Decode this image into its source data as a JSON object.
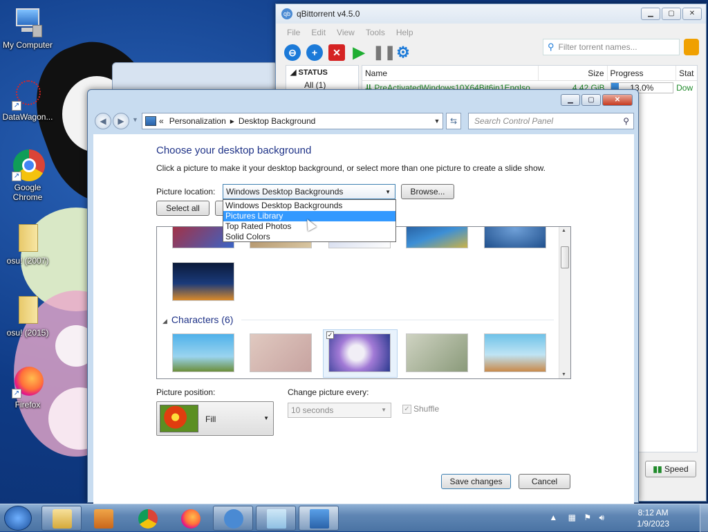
{
  "desktop": {
    "icons": [
      {
        "label": "My Computer"
      },
      {
        "label": "DataWagon..."
      },
      {
        "label": "Google Chrome"
      },
      {
        "label": "osu! (2007)"
      },
      {
        "label": "osu! (2015)"
      },
      {
        "label": "Firefox"
      }
    ]
  },
  "qbittorrent": {
    "title": "qBittorrent v4.5.0",
    "menu": [
      "File",
      "Edit",
      "View",
      "Tools",
      "Help"
    ],
    "search_placeholder": "Filter torrent names...",
    "sidebar_header": "STATUS",
    "sidebar_item": "All (1)",
    "columns": [
      "Name",
      "Size",
      "Progress",
      "Stat"
    ],
    "row": {
      "name": "PreActivatedWindows10X64Bit6in1EngIso...",
      "size": "4.42 GiB",
      "progress": "13.0%",
      "progress_value": 0.13,
      "status": "Dow"
    },
    "speed_button": "Speed"
  },
  "personalization": {
    "breadcrumb": [
      "«",
      "Personalization",
      "Desktop Background"
    ],
    "search_placeholder": "Search Control Panel",
    "heading": "Choose your desktop background",
    "description": "Click a picture to make it your desktop background, or select more than one picture to create a slide show.",
    "picture_location_label": "Picture location:",
    "picture_location_value": "Windows Desktop Backgrounds",
    "browse_button": "Browse...",
    "select_all_button": "Select all",
    "location_options": [
      "Windows Desktop Backgrounds",
      "Pictures Library",
      "Top Rated Photos",
      "Solid Colors"
    ],
    "selected_option_index": 1,
    "group_name": "Characters (6)",
    "picture_position_label": "Picture position:",
    "picture_position_value": "Fill",
    "change_every_label": "Change picture every:",
    "change_every_value": "10 seconds",
    "shuffle_label": "Shuffle",
    "save_button": "Save changes",
    "cancel_button": "Cancel"
  },
  "taskbar": {
    "time": "8:12 AM",
    "date": "1/9/2023"
  },
  "colors": {
    "accent": "#3399ff",
    "heading": "#1e3287",
    "torrent_green": "#1f8a2a"
  }
}
